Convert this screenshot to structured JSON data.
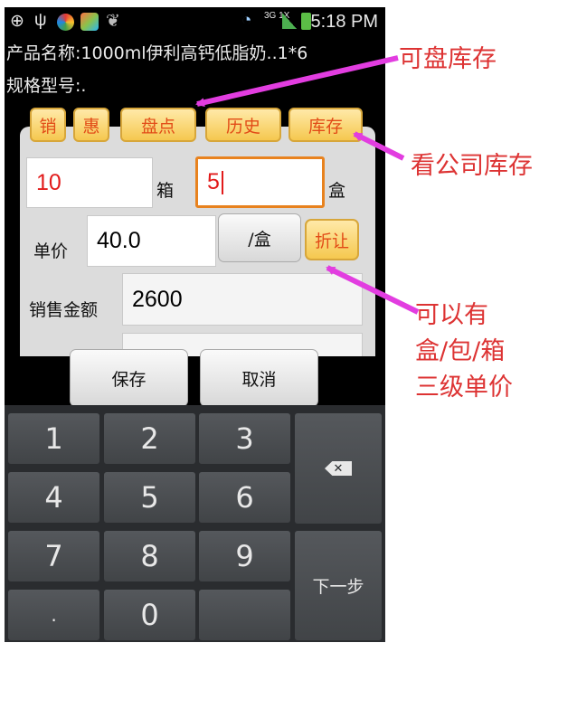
{
  "status_bar": {
    "icons": [
      "gps-icon",
      "usb-icon",
      "app-icon",
      "game-icon",
      "wechat-icon",
      "wifi-icon",
      "signal-icon",
      "battery-icon"
    ],
    "network": "3G 1X",
    "time": "5:18 PM"
  },
  "product": {
    "name_line": "产品名称:1000ml伊利高钙低脂奶..1*6",
    "spec_line": "规格型号:."
  },
  "tabs": [
    "销",
    "惠",
    "盘点",
    "历史",
    "库存"
  ],
  "quantity": {
    "box_value": "10",
    "box_unit": "箱",
    "pack_value": "5",
    "pack_unit": "盒"
  },
  "price": {
    "label": "单价",
    "value": "40.0",
    "unit_button": "/盒",
    "discount_button": "折让"
  },
  "amount": {
    "label": "销售金额",
    "value": "2600"
  },
  "actions": {
    "save": "保存",
    "cancel": "取消"
  },
  "keyboard": {
    "keys": [
      "1",
      "2",
      "3",
      "4",
      "5",
      "6",
      "7",
      "8",
      "9",
      ".",
      "0"
    ],
    "next": "下一步"
  },
  "annotations": {
    "stocktake": "可盘库存",
    "company_stock": "看公司库存",
    "price_levels_1": "可以有",
    "price_levels_2": "盒/包/箱",
    "price_levels_3": "三级单价"
  },
  "colors": {
    "tab_text": "#e24b17",
    "tab_bg": "#f5c84f",
    "annotation_text": "#dd3333",
    "arrow": "#e23de0",
    "active_field_border": "#e8821e",
    "value_text": "#e21b1b"
  }
}
